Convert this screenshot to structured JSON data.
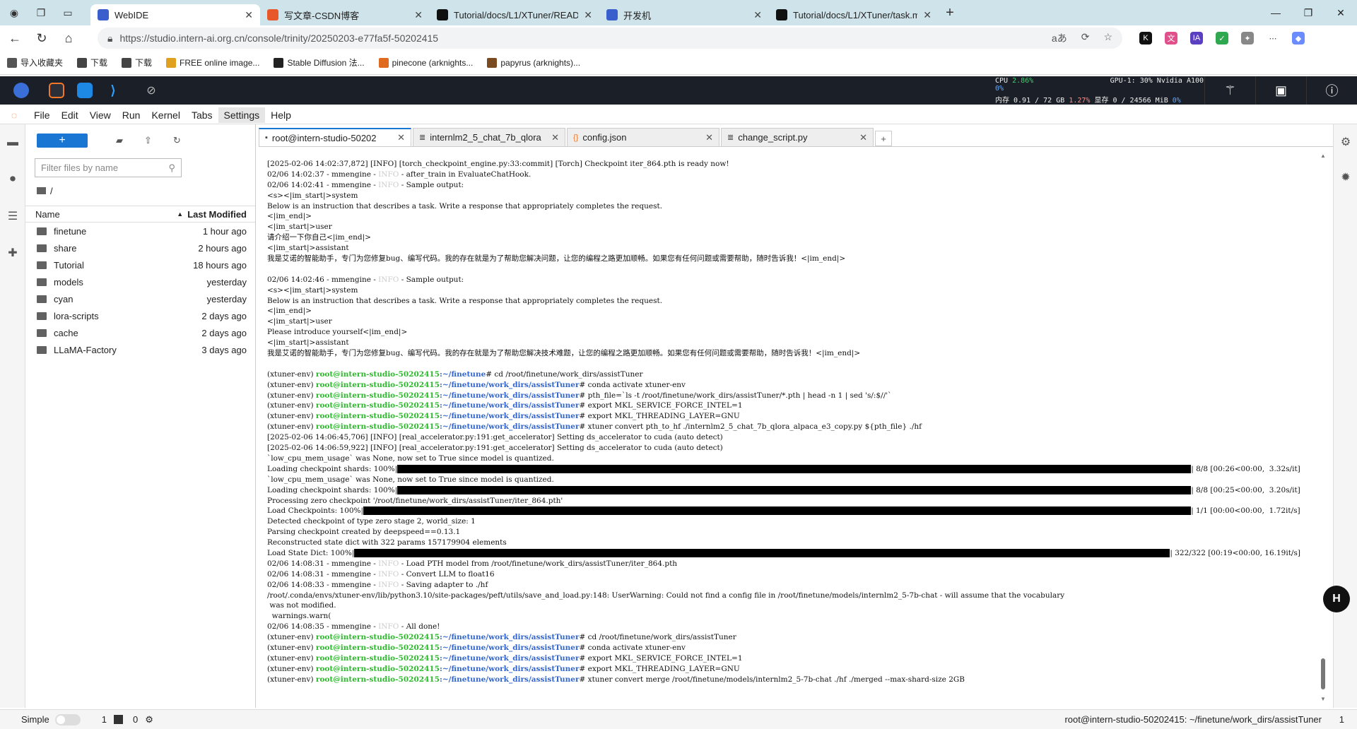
{
  "browser": {
    "tabs": [
      {
        "title": "WebIDE",
        "icon_color": "#3a5fcd",
        "active": true
      },
      {
        "title": "写文章-CSDN博客",
        "icon_color": "#e8572a",
        "active": false
      },
      {
        "title": "Tutorial/docs/L1/XTuner/READM",
        "icon_color": "#111111",
        "active": false
      },
      {
        "title": "开发机",
        "icon_color": "#3a5fcd",
        "active": false
      },
      {
        "title": "Tutorial/docs/L1/XTuner/task.md",
        "icon_color": "#111111",
        "active": false
      }
    ],
    "url": "https://studio.intern-ai.org.cn/console/trinity/20250203-e77fa5f-50202415",
    "bookmarks": [
      "导入收藏夹",
      "下载",
      "下载",
      "FREE online image...",
      "Stable Diffusion 法...",
      "pinecone (arknights...",
      "papyrus (arknights)..."
    ]
  },
  "ide": {
    "cpu_label": "CPU",
    "cpu_pct": "2.86%",
    "mem_label": "内存 0.91 / 72 GB",
    "mem_pct": "1.27%",
    "gpu_label": "GPU-1: 30% Nvidia A100",
    "gpu_pct": "0%",
    "vram_label": "显存 0 / 24566 MiB",
    "vram_pct": "0%"
  },
  "jupyter": {
    "menu": [
      "File",
      "Edit",
      "View",
      "Run",
      "Kernel",
      "Tabs",
      "Settings",
      "Help"
    ],
    "filter_placeholder": "Filter files by name",
    "breadcrumb": "/",
    "col_name": "Name",
    "col_modified": "Last Modified",
    "files": [
      {
        "name": "finetune",
        "modified": "1 hour ago"
      },
      {
        "name": "share",
        "modified": "2 hours ago"
      },
      {
        "name": "Tutorial",
        "modified": "18 hours ago"
      },
      {
        "name": "models",
        "modified": "yesterday"
      },
      {
        "name": "cyan",
        "modified": "yesterday"
      },
      {
        "name": "lora-scripts",
        "modified": "2 days ago"
      },
      {
        "name": "cache",
        "modified": "2 days ago"
      },
      {
        "name": "LLaMA-Factory",
        "modified": "3 days ago"
      }
    ],
    "tabs": [
      {
        "title": "root@intern-studio-50202",
        "icon": "terminal",
        "active": true
      },
      {
        "title": "internlm2_5_chat_7b_qlora",
        "icon": "text",
        "active": false
      },
      {
        "title": "config.json",
        "icon": "json",
        "active": false
      },
      {
        "title": "change_script.py",
        "icon": "text",
        "active": false
      }
    ],
    "status": {
      "mode": "Simple",
      "count1": "1",
      "count2": "0",
      "path": "root@intern-studio-50202415: ~/finetune/work_dirs/assistTuner",
      "right_num": "1"
    }
  },
  "terminal": {
    "prompt_env": "(xtuner-env) ",
    "prompt_host": "root@intern-studio-50202415",
    "lines": [
      {
        "t": "[2025-02-06 14:02:37,872] [INFO] [torch_checkpoint_engine.py:33:commit] [Torch] Checkpoint iter_864.pth is ready now!"
      },
      {
        "pre": "02/06 14:02:37 - mmengine - ",
        "info": "INFO",
        "post": " - after_train in EvaluateChatHook."
      },
      {
        "pre": "02/06 14:02:41 - mmengine - ",
        "info": "INFO",
        "post": " - Sample output:"
      },
      {
        "t": "<s><|im_start|>system"
      },
      {
        "t": "Below is an instruction that describes a task. Write a response that appropriately completes the request."
      },
      {
        "t": "<|im_end|>"
      },
      {
        "t": "<|im_start|>user"
      },
      {
        "t": "请介绍一下你自己<|im_end|>"
      },
      {
        "t": "<|im_start|>assistant"
      },
      {
        "t": "我是艾诺的智能助手，专门为您修复bug、编写代码。我的存在就是为了帮助您解决问题，让您的编程之路更加顺畅。如果您有任何问题或需要帮助，随时告诉我！<|im_end|>"
      },
      {
        "t": ""
      },
      {
        "pre": "02/06 14:02:46 - mmengine - ",
        "info": "INFO",
        "post": " - Sample output:"
      },
      {
        "t": "<s><|im_start|>system"
      },
      {
        "t": "Below is an instruction that describes a task. Write a response that appropriately completes the request."
      },
      {
        "t": "<|im_end|>"
      },
      {
        "t": "<|im_start|>user"
      },
      {
        "t": "Please introduce yourself<|im_end|>"
      },
      {
        "t": "<|im_start|>assistant"
      },
      {
        "t": "我是艾诺的智能助手，专门为您修复bug、编写代码。我的存在就是为了帮助您解决技术难题，让您的编程之路更加顺畅。如果您有任何问题或需要帮助，随时告诉我！<|im_end|>"
      },
      {
        "t": ""
      },
      {
        "prompt": true,
        "path": ":~/finetune",
        "cmd": "# cd /root/finetune/work_dirs/assistTuner"
      },
      {
        "prompt": true,
        "path": ":~/finetune/work_dirs/assistTuner",
        "cmd": "# conda activate xtuner-env"
      },
      {
        "prompt": true,
        "path": ":~/finetune/work_dirs/assistTuner",
        "cmd": "# pth_file=`ls -t /root/finetune/work_dirs/assistTuner/*.pth | head -n 1 | sed 's/:$//'`"
      },
      {
        "prompt": true,
        "path": ":~/finetune/work_dirs/assistTuner",
        "cmd": "# export MKL_SERVICE_FORCE_INTEL=1"
      },
      {
        "prompt": true,
        "path": ":~/finetune/work_dirs/assistTuner",
        "cmd": "# export MKL_THREADING_LAYER=GNU"
      },
      {
        "prompt": true,
        "path": ":~/finetune/work_dirs/assistTuner",
        "cmd": "# xtuner convert pth_to_hf ./internlm2_5_chat_7b_qlora_alpaca_e3_copy.py ${pth_file} ./hf"
      },
      {
        "t": "[2025-02-06 14:06:45,706] [INFO] [real_accelerator.py:191:get_accelerator] Setting ds_accelerator to cuda (auto detect)"
      },
      {
        "t": "[2025-02-06 14:06:59,922] [INFO] [real_accelerator.py:191:get_accelerator] Setting ds_accelerator to cuda (auto detect)"
      },
      {
        "t": "`low_cpu_mem_usage` was None, now set to True since model is quantized."
      },
      {
        "pre": "Loading checkpoint shards: 100%|",
        "progress": 1.0,
        "post": "| 8/8 [00:26<00:00,  3.32s/it]"
      },
      {
        "t": "`low_cpu_mem_usage` was None, now set to True since model is quantized."
      },
      {
        "pre": "Loading checkpoint shards: 100%|",
        "progress": 1.0,
        "post": "| 8/8 [00:25<00:00,  3.20s/it]"
      },
      {
        "t": "Processing zero checkpoint '/root/finetune/work_dirs/assistTuner/iter_864.pth'"
      },
      {
        "pre": "Load Checkpoints: 100%|",
        "progress": 1.0,
        "post": "| 1/1 [00:00<00:00,  1.72it/s]"
      },
      {
        "t": "Detected checkpoint of type zero stage 2, world_size: 1"
      },
      {
        "t": "Parsing checkpoint created by deepspeed==0.13.1"
      },
      {
        "t": "Reconstructed state dict with 322 params 157179904 elements"
      },
      {
        "pre": "Load State Dict: 100%|",
        "progress": 1.0,
        "post": "| 322/322 [00:19<00:00, 16.19it/s]"
      },
      {
        "pre": "02/06 14:08:31 - mmengine - ",
        "info": "INFO",
        "post": " - Load PTH model from /root/finetune/work_dirs/assistTuner/iter_864.pth"
      },
      {
        "pre": "02/06 14:08:31 - mmengine - ",
        "info": "INFO",
        "post": " - Convert LLM to float16"
      },
      {
        "pre": "02/06 14:08:33 - mmengine - ",
        "info": "INFO",
        "post": " - Saving adapter to ./hf"
      },
      {
        "t": "/root/.conda/envs/xtuner-env/lib/python3.10/site-packages/peft/utils/save_and_load.py:148: UserWarning: Could not find a config file in /root/finetune/models/internlm2_5-7b-chat - will assume that the vocabulary"
      },
      {
        "t": " was not modified."
      },
      {
        "t": "  warnings.warn("
      },
      {
        "pre": "02/06 14:08:35 - mmengine - ",
        "info": "INFO",
        "post": " - All done!"
      },
      {
        "prompt": true,
        "path": ":~/finetune/work_dirs/assistTuner",
        "cmd": "# cd /root/finetune/work_dirs/assistTuner"
      },
      {
        "prompt": true,
        "path": ":~/finetune/work_dirs/assistTuner",
        "cmd": "# conda activate xtuner-env"
      },
      {
        "prompt": true,
        "path": ":~/finetune/work_dirs/assistTuner",
        "cmd": "# export MKL_SERVICE_FORCE_INTEL=1"
      },
      {
        "prompt": true,
        "path": ":~/finetune/work_dirs/assistTuner",
        "cmd": "# export MKL_THREADING_LAYER=GNU"
      },
      {
        "prompt": true,
        "path": ":~/finetune/work_dirs/assistTuner",
        "cmd": "# xtuner convert merge /root/finetune/models/internlm2_5-7b-chat ./hf ./merged --max-shard-size 2GB"
      }
    ]
  }
}
